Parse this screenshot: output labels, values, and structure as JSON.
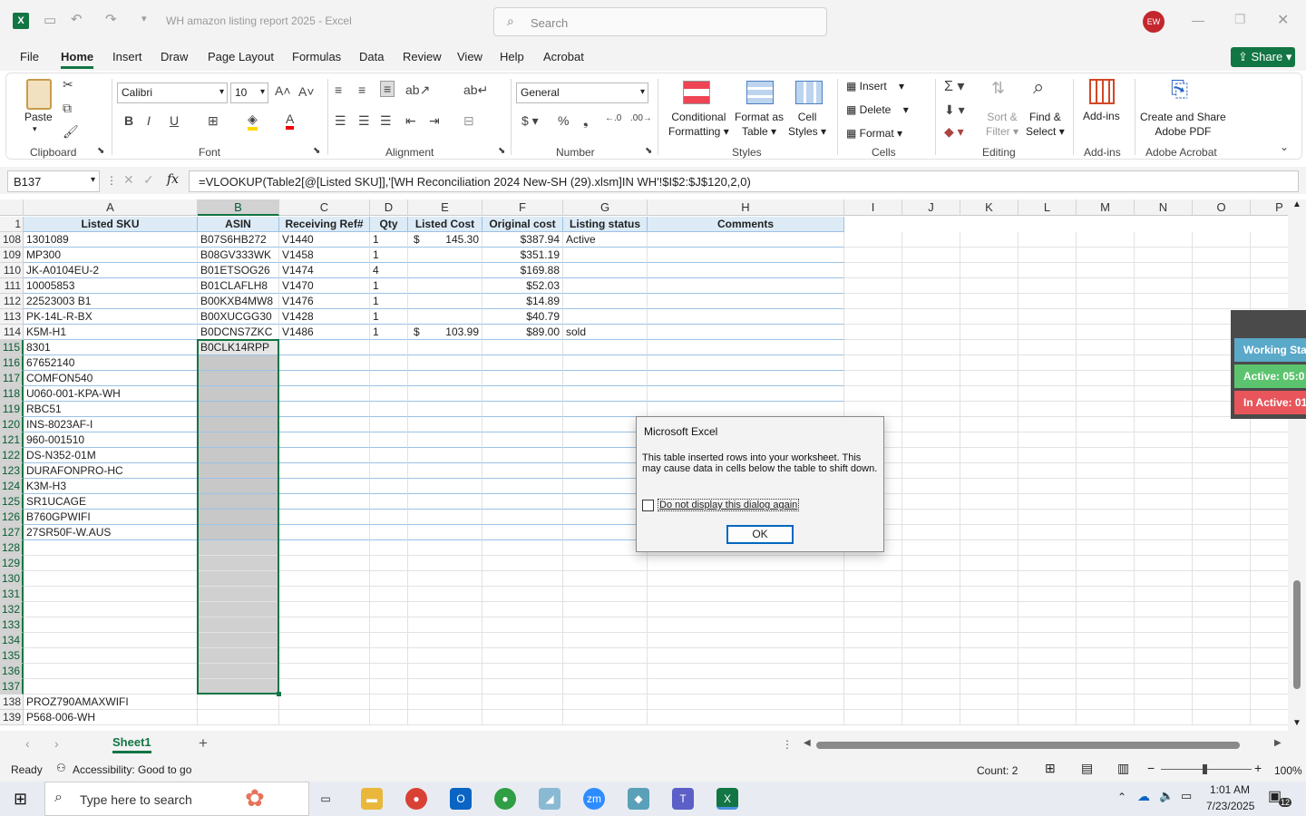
{
  "window": {
    "title": "WH amazon listing report 2025  -  Excel",
    "search_placeholder": "Search",
    "user_initials": "EW"
  },
  "menu_tabs": [
    "File",
    "Home",
    "Insert",
    "Draw",
    "Page Layout",
    "Formulas",
    "Data",
    "Review",
    "View",
    "Help",
    "Acrobat"
  ],
  "share_label": "Share",
  "ribbon": {
    "paste": "Paste",
    "font_name": "Calibri",
    "font_size": "10",
    "number_format": "General",
    "conditional_formatting": [
      "Conditional",
      "Formatting"
    ],
    "format_as_table": [
      "Format as",
      "Table"
    ],
    "cell_styles": [
      "Cell",
      "Styles"
    ],
    "insert": "Insert",
    "delete": "Delete",
    "format": "Format",
    "sort_filter": [
      "Sort &",
      "Filter"
    ],
    "find_select": [
      "Find &",
      "Select"
    ],
    "addins": "Add-ins",
    "create_share": [
      "Create and Share",
      "Adobe PDF"
    ],
    "groups": [
      "Clipboard",
      "Font",
      "Alignment",
      "Number",
      "Styles",
      "Cells",
      "Editing",
      "Add-ins",
      "Adobe Acrobat"
    ]
  },
  "formula_bar": {
    "name_box": "B137",
    "formula": "=VLOOKUP(Table2[@[Listed SKU]],'[WH Reconciliation 2024 New-SH (29).xlsm]IN WH'!$I$2:$J$120,2,0)"
  },
  "columns": [
    "A",
    "B",
    "C",
    "D",
    "E",
    "F",
    "G",
    "H",
    "I",
    "J",
    "K",
    "L",
    "M",
    "N",
    "O",
    "P"
  ],
  "headers": [
    "Listed SKU",
    "ASIN",
    "Receiving Ref#",
    "Qty",
    "Listed Cost",
    "Original cost",
    "Listing status",
    "Comments"
  ],
  "rows": [
    {
      "n": "108",
      "a": "1301089",
      "b": "B07S6HB272",
      "c": "V1440",
      "d": "1",
      "e1": "$",
      "e2": "145.30",
      "f": "$387.94",
      "g": "Active"
    },
    {
      "n": "109",
      "a": "MP300",
      "b": "B08GV333WK",
      "c": "V1458",
      "d": "1",
      "e1": "",
      "e2": "",
      "f": "$351.19",
      "g": ""
    },
    {
      "n": "110",
      "a": "JK-A0104EU-2",
      "b": "B01ETSOG26",
      "c": "V1474",
      "d": "4",
      "e1": "",
      "e2": "",
      "f": "$169.88",
      "g": ""
    },
    {
      "n": "111",
      "a": "10005853",
      "b": "B01CLAFLH8",
      "c": "V1470",
      "d": "1",
      "e1": "",
      "e2": "",
      "f": "$52.03",
      "g": ""
    },
    {
      "n": "112",
      "a": "22523003 B1",
      "b": "B00KXB4MW8",
      "c": "V1476",
      "d": "1",
      "e1": "",
      "e2": "",
      "f": "$14.89",
      "g": ""
    },
    {
      "n": "113",
      "a": "PK-14L-R-BX",
      "b": "B00XUCGG30",
      "c": "V1428",
      "d": "1",
      "e1": "",
      "e2": "",
      "f": "$40.79",
      "g": ""
    },
    {
      "n": "114",
      "a": "K5M-H1",
      "b": "B0DCNS7ZKC",
      "c": "V1486",
      "d": "1",
      "e1": "$",
      "e2": "103.99",
      "f": "$89.00",
      "g": "sold"
    },
    {
      "n": "115",
      "a": "8301",
      "b": "B0CLK14RPP",
      "c": "",
      "d": "",
      "e1": "",
      "e2": "",
      "f": "",
      "g": ""
    },
    {
      "n": "116",
      "a": "67652140",
      "b": "",
      "c": "",
      "d": "",
      "e1": "",
      "e2": "",
      "f": "",
      "g": ""
    },
    {
      "n": "117",
      "a": "COMFON540",
      "b": "",
      "c": "",
      "d": "",
      "e1": "",
      "e2": "",
      "f": "",
      "g": ""
    },
    {
      "n": "118",
      "a": "U060-001-KPA-WH",
      "b": "",
      "c": "",
      "d": "",
      "e1": "",
      "e2": "",
      "f": "",
      "g": ""
    },
    {
      "n": "119",
      "a": "RBC51",
      "b": "",
      "c": "",
      "d": "",
      "e1": "",
      "e2": "",
      "f": "",
      "g": ""
    },
    {
      "n": "120",
      "a": "INS-8023AF-I",
      "b": "",
      "c": "",
      "d": "",
      "e1": "",
      "e2": "",
      "f": "",
      "g": ""
    },
    {
      "n": "121",
      "a": "960-001510",
      "b": "",
      "c": "",
      "d": "",
      "e1": "",
      "e2": "",
      "f": "",
      "g": ""
    },
    {
      "n": "122",
      "a": "DS-N352-01M",
      "b": "",
      "c": "",
      "d": "",
      "e1": "",
      "e2": "",
      "f": "",
      "g": ""
    },
    {
      "n": "123",
      "a": "DURAFONPRO-HC",
      "b": "",
      "c": "",
      "d": "",
      "e1": "",
      "e2": "",
      "f": "",
      "g": ""
    },
    {
      "n": "124",
      "a": "K3M-H3",
      "b": "",
      "c": "",
      "d": "",
      "e1": "",
      "e2": "",
      "f": "",
      "g": ""
    },
    {
      "n": "125",
      "a": "SR1UCAGE",
      "b": "",
      "c": "",
      "d": "",
      "e1": "",
      "e2": "",
      "f": "",
      "g": ""
    },
    {
      "n": "126",
      "a": "B760GPWIFI",
      "b": "",
      "c": "",
      "d": "",
      "e1": "",
      "e2": "",
      "f": "",
      "g": ""
    },
    {
      "n": "127",
      "a": "27SR50F-W.AUS",
      "b": "",
      "c": "",
      "d": "",
      "e1": "",
      "e2": "",
      "f": "",
      "g": ""
    },
    {
      "n": "128",
      "a": "",
      "b": "",
      "c": "",
      "d": "",
      "e1": "",
      "e2": "",
      "f": "",
      "g": ""
    },
    {
      "n": "129",
      "a": "",
      "b": "",
      "c": "",
      "d": "",
      "e1": "",
      "e2": "",
      "f": "",
      "g": ""
    },
    {
      "n": "130",
      "a": "",
      "b": "",
      "c": "",
      "d": "",
      "e1": "",
      "e2": "",
      "f": "",
      "g": ""
    },
    {
      "n": "131",
      "a": "",
      "b": "",
      "c": "",
      "d": "",
      "e1": "",
      "e2": "",
      "f": "",
      "g": ""
    },
    {
      "n": "132",
      "a": "",
      "b": "",
      "c": "",
      "d": "",
      "e1": "",
      "e2": "",
      "f": "",
      "g": ""
    },
    {
      "n": "133",
      "a": "",
      "b": "",
      "c": "",
      "d": "",
      "e1": "",
      "e2": "",
      "f": "",
      "g": ""
    },
    {
      "n": "134",
      "a": "",
      "b": "",
      "c": "",
      "d": "",
      "e1": "",
      "e2": "",
      "f": "",
      "g": ""
    },
    {
      "n": "135",
      "a": "",
      "b": "",
      "c": "",
      "d": "",
      "e1": "",
      "e2": "",
      "f": "",
      "g": ""
    },
    {
      "n": "136",
      "a": "",
      "b": "",
      "c": "",
      "d": "",
      "e1": "",
      "e2": "",
      "f": "",
      "g": ""
    },
    {
      "n": "137",
      "a": "",
      "b": "",
      "c": "",
      "d": "",
      "e1": "",
      "e2": "",
      "f": "",
      "g": ""
    },
    {
      "n": "138",
      "a": "PROZ790AMAXWIFI",
      "b": "",
      "c": "",
      "d": "",
      "e1": "",
      "e2": "",
      "f": "",
      "g": ""
    },
    {
      "n": "139",
      "a": "P568-006-WH",
      "b": "",
      "c": "",
      "d": "",
      "e1": "",
      "e2": "",
      "f": "",
      "g": ""
    }
  ],
  "dialog": {
    "title": "Microsoft Excel",
    "message": "This table inserted rows into your worksheet. This may cause data in cells below the table to shift down.",
    "checkbox_label": "Do not display this dialog again",
    "ok_label": "OK"
  },
  "side_widget": {
    "working": "Working Sta",
    "active": "Active: 05:0",
    "inactive": "In Active: 01"
  },
  "sheet_tab": "Sheet1",
  "status": {
    "ready": "Ready",
    "accessibility": "Accessibility: Good to go",
    "count": "Count: 2",
    "zoom": "100%"
  },
  "taskbar": {
    "search_placeholder": "Type here to search",
    "time": "1:01 AM",
    "date": "7/23/2025",
    "notifications": "12"
  },
  "colors": {
    "excel_green": "#127544",
    "table_header": "#ddebf7",
    "selection_gray": "#c8c8c8"
  }
}
